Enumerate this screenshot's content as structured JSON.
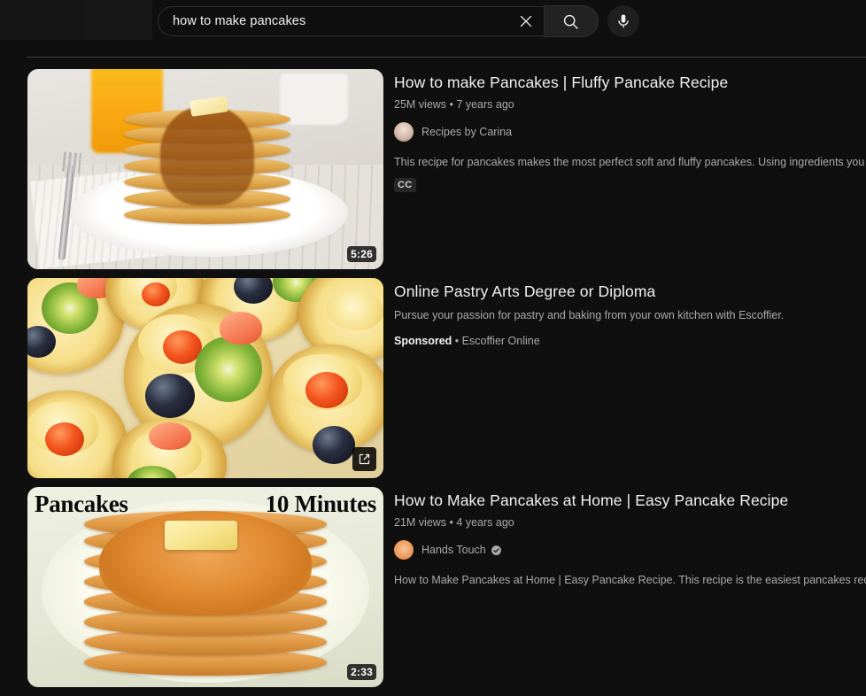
{
  "search": {
    "query": "how to make pancakes",
    "placeholder": "Search",
    "clear_label": "Clear search query",
    "search_label": "Search",
    "mic_label": "Search with your voice"
  },
  "results": [
    {
      "kind": "video",
      "title": "How to make Pancakes | Fluffy Pancake Recipe",
      "views": "25M views",
      "separator": "•",
      "published": "7 years ago",
      "channel": "Recipes by Carina",
      "verified": false,
      "description": "This recipe for pancakes makes the most perfect soft and fluffy pancakes. Using ingredients you should already have in your ...",
      "duration": "5:26",
      "badges": [
        "CC"
      ]
    },
    {
      "kind": "ad",
      "title": "Online Pastry Arts Degree or Diploma",
      "description": "Pursue your passion for pastry and baking from your own kitchen with Escoffier.",
      "sponsored_label": "Sponsored",
      "separator": "•",
      "advertiser": "Escoffier Online",
      "visit_label": "Visit advertiser site"
    },
    {
      "kind": "video",
      "title": "How to Make Pancakes at Home | Easy Pancake Recipe",
      "views": "21M views",
      "separator": "•",
      "published": "4 years ago",
      "channel": "Hands Touch",
      "verified": true,
      "description": "How to Make Pancakes at Home | Easy Pancake Recipe. This recipe is the easiest pancakes recipe I tried ever. For this pancak...",
      "duration": "2:33",
      "thumbnail_text_left": "Pancakes",
      "thumbnail_text_right": "10 Minutes",
      "badges": []
    }
  ],
  "colors": {
    "background": "#0f0f0f",
    "text_primary": "#f1f1f1",
    "text_secondary": "#aaaaaa",
    "divider": "#3f3f3f",
    "badge_background": "#272727"
  }
}
